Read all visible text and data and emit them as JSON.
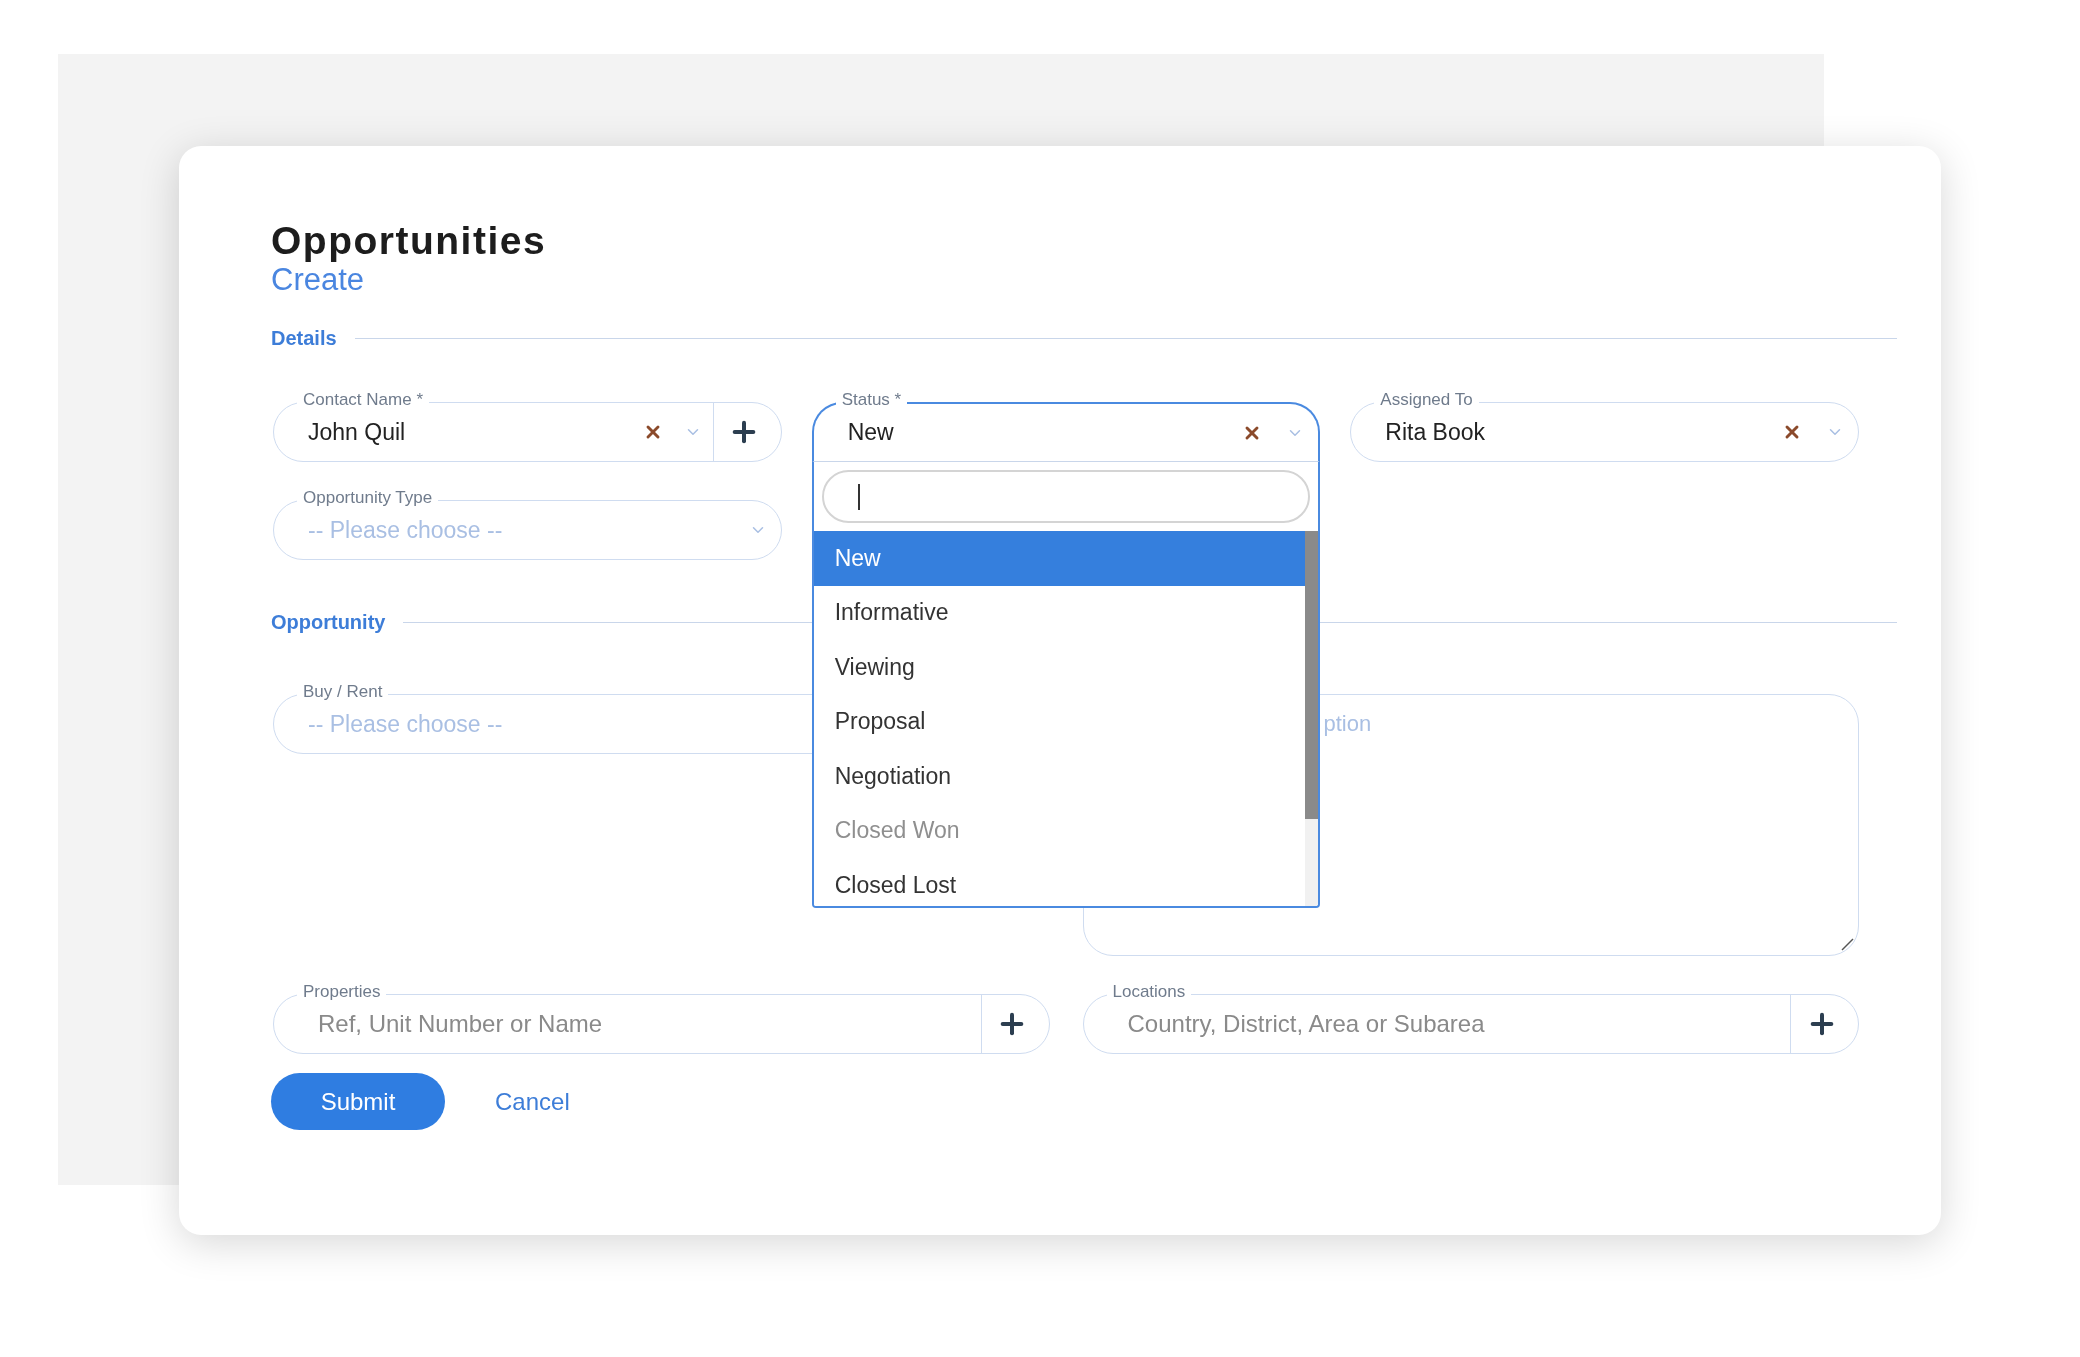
{
  "header": {
    "title": "Opportunities",
    "subtitle": "Create"
  },
  "sections": [
    {
      "title": "Details",
      "fields": [
        {
          "kind": "select",
          "label": "Contact Name *",
          "value": "John Quil",
          "clearable": true,
          "add": true,
          "open": false,
          "chevron": true
        },
        {
          "kind": "select",
          "label": "Status *",
          "value": "New",
          "clearable": true,
          "add": false,
          "open": true,
          "chevron": true,
          "options": [
            {
              "label": "New",
              "selected": true,
              "disabled": false
            },
            {
              "label": "Informative",
              "selected": false,
              "disabled": false
            },
            {
              "label": "Viewing",
              "selected": false,
              "disabled": false
            },
            {
              "label": "Proposal",
              "selected": false,
              "disabled": false
            },
            {
              "label": "Negotiation",
              "selected": false,
              "disabled": false
            },
            {
              "label": "Closed Won",
              "selected": false,
              "disabled": true
            },
            {
              "label": "Closed Lost",
              "selected": false,
              "disabled": false
            }
          ]
        },
        {
          "kind": "select",
          "label": "Assigned To",
          "value": "Rita Book",
          "clearable": true,
          "add": false,
          "open": false,
          "chevron": true
        },
        {
          "kind": "select",
          "label": "Opportunity Type",
          "placeholder": "-- Please choose --",
          "clearable": false,
          "add": false,
          "open": false,
          "chevron": true
        }
      ]
    },
    {
      "title": "Opportunity",
      "fields": [
        {
          "kind": "select",
          "label": "Buy / Rent",
          "placeholder": "-- Please choose --",
          "open": false
        },
        {
          "kind": "textarea",
          "placeholder": "ption"
        },
        {
          "kind": "lookup",
          "label": "Properties",
          "placeholder": "Ref, Unit Number or Name",
          "add": true
        },
        {
          "kind": "lookup",
          "label": "Locations",
          "placeholder": "Country, District, Area or Subarea",
          "add": true
        }
      ]
    }
  ],
  "actions": {
    "submit": "Submit",
    "cancel": "Cancel"
  }
}
